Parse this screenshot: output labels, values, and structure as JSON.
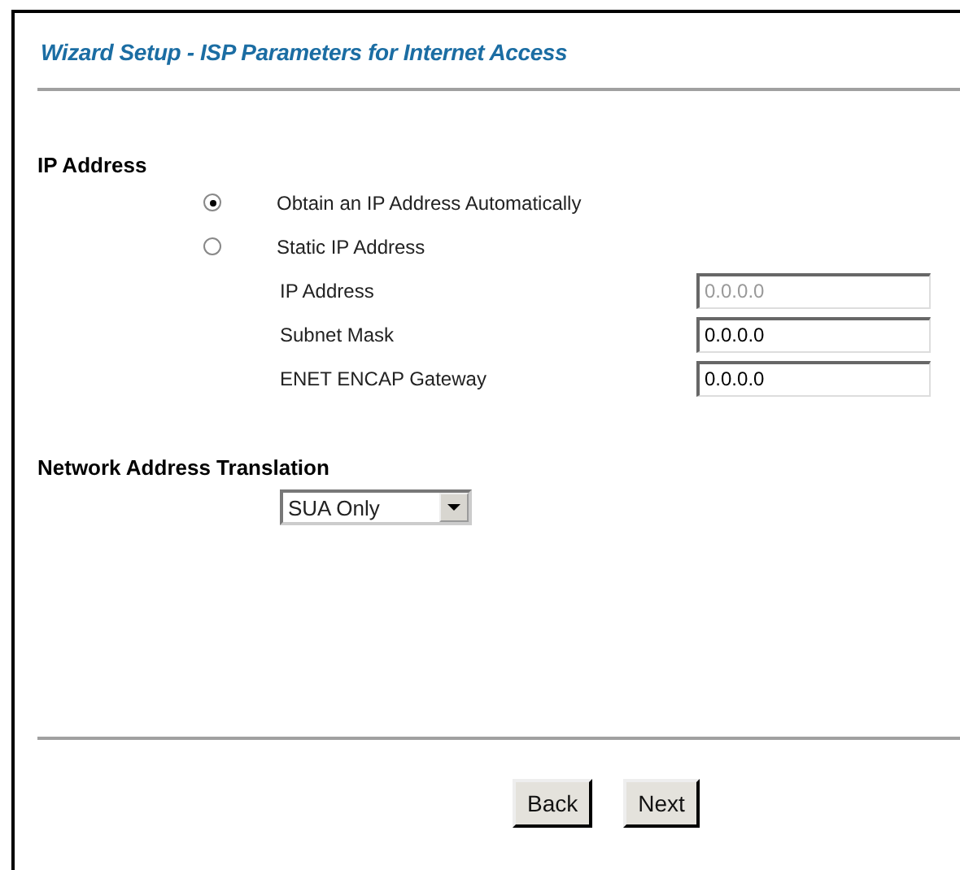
{
  "title": "Wizard Setup - ISP Parameters for Internet Access",
  "ip_section": {
    "heading": "IP Address",
    "options": [
      {
        "label": "Obtain an IP Address Automatically",
        "selected": true
      },
      {
        "label": "Static IP Address",
        "selected": false
      }
    ],
    "fields": [
      {
        "label": "IP Address",
        "value": "0.0.0.0",
        "disabled": true
      },
      {
        "label": "Subnet Mask",
        "value": "0.0.0.0",
        "disabled": false
      },
      {
        "label": "ENET ENCAP Gateway",
        "value": "0.0.0.0",
        "disabled": false
      }
    ]
  },
  "nat_section": {
    "heading": "Network Address Translation",
    "value": "SUA Only"
  },
  "buttons": [
    "Back",
    "Next"
  ]
}
